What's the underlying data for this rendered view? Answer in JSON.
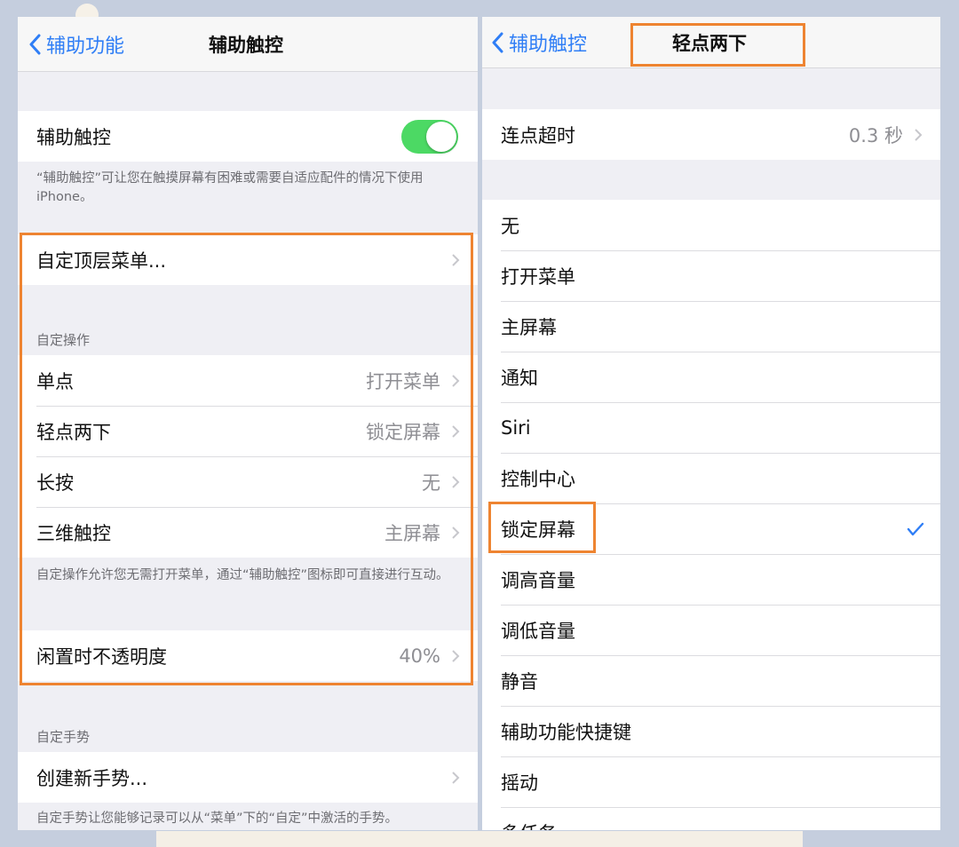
{
  "left": {
    "nav": {
      "back_label": "辅助功能",
      "title": "辅助触控"
    },
    "assistive_touch": {
      "label": "辅助触控",
      "enabled": true,
      "toggle_color": "#4cd964"
    },
    "assistive_touch_footnote": "“辅助触控”可让您在触摸屏幕有困难或需要自适应配件的情况下使用 iPhone。",
    "customize_menu": {
      "label": "自定顶层菜单..."
    },
    "custom_actions": {
      "header": "自定操作",
      "items": [
        {
          "label": "单点",
          "value": "打开菜单"
        },
        {
          "label": "轻点两下",
          "value": "锁定屏幕"
        },
        {
          "label": "长按",
          "value": "无"
        },
        {
          "label": "三维触控",
          "value": "主屏幕"
        }
      ],
      "footnote": "自定操作允许您无需打开菜单，通过“辅助触控”图标即可直接进行互动。"
    },
    "idle_opacity": {
      "label": "闲置时不透明度",
      "value": "40%"
    },
    "custom_gestures": {
      "header": "自定手势",
      "create_label": "创建新手势...",
      "footnote": "自定手势让您能够记录可以从“菜单”下的“自定”中激活的手势。"
    }
  },
  "right": {
    "nav": {
      "back_label": "辅助触控",
      "title": "轻点两下"
    },
    "timeout": {
      "label": "连点超时",
      "value": "0.3 秒"
    },
    "options": [
      "无",
      "打开菜单",
      "主屏幕",
      "通知",
      "Siri",
      "控制中心",
      "锁定屏幕",
      "调高音量",
      "调低音量",
      "静音",
      "辅助功能快捷键",
      "摇动",
      "多任务"
    ],
    "selected": "锁定屏幕"
  },
  "colors": {
    "accent": "#2f7ef6",
    "highlight": "#ee8431",
    "background": "#c5cede"
  }
}
